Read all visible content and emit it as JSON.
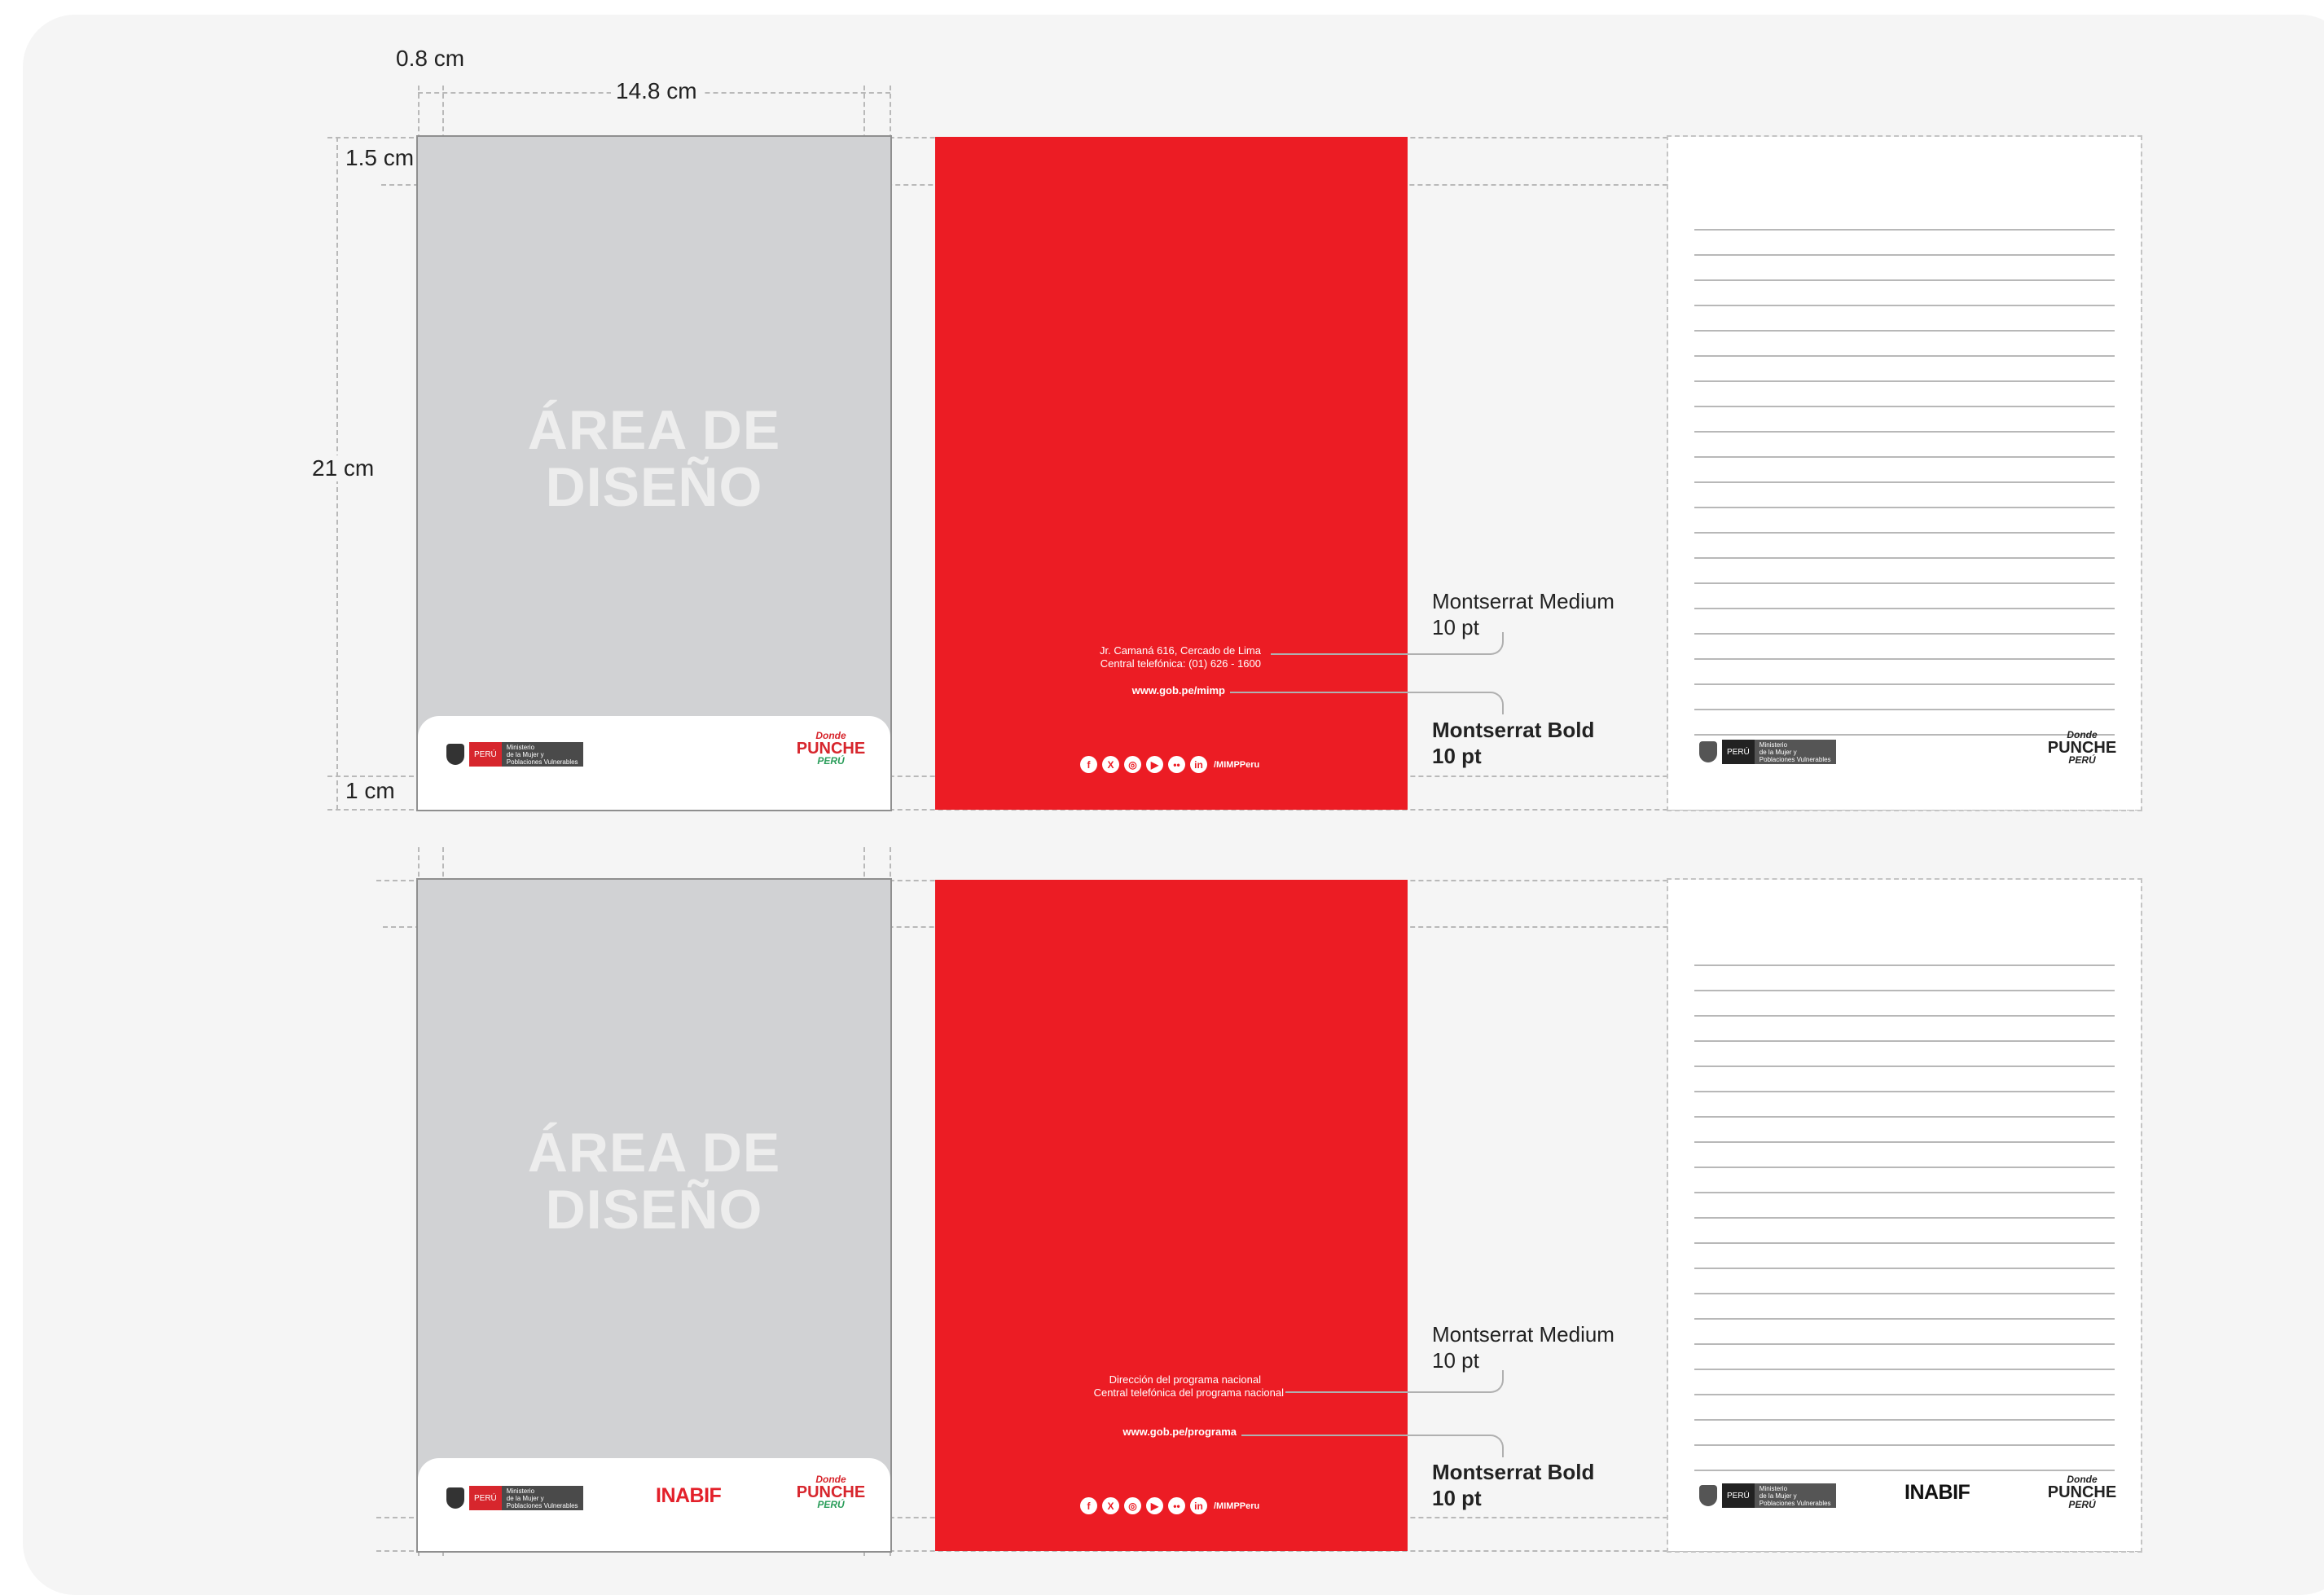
{
  "dimensions": {
    "margin_side": "0.8 cm",
    "width": "14.8 cm",
    "margin_top": "1.5 cm",
    "height": "21 cm",
    "margin_bottom": "1 cm"
  },
  "design_area": {
    "line1": "ÁREA DE",
    "line2": "DISEÑO"
  },
  "logos": {
    "peru": "PERÚ",
    "ministry_lines": [
      "Ministerio",
      "de la Mujer y",
      "Poblaciones Vulnerables"
    ],
    "brand_top": "Donde",
    "brand_mid": "PUNCHE",
    "brand_bottom": "PERÚ",
    "inabif": "INABIF"
  },
  "rows": [
    {
      "contact_line1": "Jr. Camaná 616, Cercado de Lima",
      "contact_line2": "Central telefónica: (01) 626 - 1600",
      "url": "www.gob.pe/mimp",
      "social_handle": "/MIMPPeru",
      "annotation_medium": [
        "Montserrat Medium",
        "10 pt"
      ],
      "annotation_bold": [
        "Montserrat Bold",
        "10 pt"
      ]
    },
    {
      "contact_line1": "Dirección del programa nacional",
      "contact_line2": "Central telefónica del programa nacional",
      "url": "www.gob.pe/programa",
      "social_handle": "/MIMPPeru",
      "annotation_medium": [
        "Montserrat Medium",
        "10 pt"
      ],
      "annotation_bold": [
        "Montserrat Bold",
        "10 pt"
      ]
    }
  ],
  "social_icons": [
    "facebook-icon",
    "x-icon",
    "instagram-icon",
    "youtube-icon",
    "flickr-icon",
    "linkedin-icon"
  ],
  "colors": {
    "red": "#ec1c24",
    "grey_area": "#d1d2d4",
    "board": "#f5f5f5",
    "dark_box": "#4a4a4a"
  }
}
